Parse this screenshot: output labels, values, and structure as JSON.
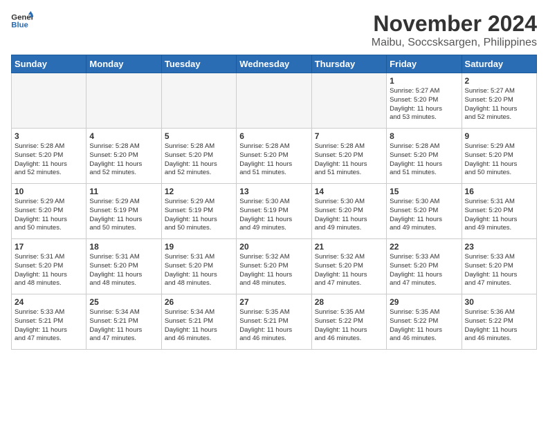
{
  "header": {
    "logo_line1": "General",
    "logo_line2": "Blue",
    "title": "November 2024",
    "subtitle": "Maibu, Soccsksargen, Philippines"
  },
  "days_of_week": [
    "Sunday",
    "Monday",
    "Tuesday",
    "Wednesday",
    "Thursday",
    "Friday",
    "Saturday"
  ],
  "weeks": [
    [
      {
        "day": "",
        "info": ""
      },
      {
        "day": "",
        "info": ""
      },
      {
        "day": "",
        "info": ""
      },
      {
        "day": "",
        "info": ""
      },
      {
        "day": "",
        "info": ""
      },
      {
        "day": "1",
        "info": "Sunrise: 5:27 AM\nSunset: 5:20 PM\nDaylight: 11 hours\nand 53 minutes."
      },
      {
        "day": "2",
        "info": "Sunrise: 5:27 AM\nSunset: 5:20 PM\nDaylight: 11 hours\nand 52 minutes."
      }
    ],
    [
      {
        "day": "3",
        "info": "Sunrise: 5:28 AM\nSunset: 5:20 PM\nDaylight: 11 hours\nand 52 minutes."
      },
      {
        "day": "4",
        "info": "Sunrise: 5:28 AM\nSunset: 5:20 PM\nDaylight: 11 hours\nand 52 minutes."
      },
      {
        "day": "5",
        "info": "Sunrise: 5:28 AM\nSunset: 5:20 PM\nDaylight: 11 hours\nand 52 minutes."
      },
      {
        "day": "6",
        "info": "Sunrise: 5:28 AM\nSunset: 5:20 PM\nDaylight: 11 hours\nand 51 minutes."
      },
      {
        "day": "7",
        "info": "Sunrise: 5:28 AM\nSunset: 5:20 PM\nDaylight: 11 hours\nand 51 minutes."
      },
      {
        "day": "8",
        "info": "Sunrise: 5:28 AM\nSunset: 5:20 PM\nDaylight: 11 hours\nand 51 minutes."
      },
      {
        "day": "9",
        "info": "Sunrise: 5:29 AM\nSunset: 5:20 PM\nDaylight: 11 hours\nand 50 minutes."
      }
    ],
    [
      {
        "day": "10",
        "info": "Sunrise: 5:29 AM\nSunset: 5:20 PM\nDaylight: 11 hours\nand 50 minutes."
      },
      {
        "day": "11",
        "info": "Sunrise: 5:29 AM\nSunset: 5:19 PM\nDaylight: 11 hours\nand 50 minutes."
      },
      {
        "day": "12",
        "info": "Sunrise: 5:29 AM\nSunset: 5:19 PM\nDaylight: 11 hours\nand 50 minutes."
      },
      {
        "day": "13",
        "info": "Sunrise: 5:30 AM\nSunset: 5:19 PM\nDaylight: 11 hours\nand 49 minutes."
      },
      {
        "day": "14",
        "info": "Sunrise: 5:30 AM\nSunset: 5:20 PM\nDaylight: 11 hours\nand 49 minutes."
      },
      {
        "day": "15",
        "info": "Sunrise: 5:30 AM\nSunset: 5:20 PM\nDaylight: 11 hours\nand 49 minutes."
      },
      {
        "day": "16",
        "info": "Sunrise: 5:31 AM\nSunset: 5:20 PM\nDaylight: 11 hours\nand 49 minutes."
      }
    ],
    [
      {
        "day": "17",
        "info": "Sunrise: 5:31 AM\nSunset: 5:20 PM\nDaylight: 11 hours\nand 48 minutes."
      },
      {
        "day": "18",
        "info": "Sunrise: 5:31 AM\nSunset: 5:20 PM\nDaylight: 11 hours\nand 48 minutes."
      },
      {
        "day": "19",
        "info": "Sunrise: 5:31 AM\nSunset: 5:20 PM\nDaylight: 11 hours\nand 48 minutes."
      },
      {
        "day": "20",
        "info": "Sunrise: 5:32 AM\nSunset: 5:20 PM\nDaylight: 11 hours\nand 48 minutes."
      },
      {
        "day": "21",
        "info": "Sunrise: 5:32 AM\nSunset: 5:20 PM\nDaylight: 11 hours\nand 47 minutes."
      },
      {
        "day": "22",
        "info": "Sunrise: 5:33 AM\nSunset: 5:20 PM\nDaylight: 11 hours\nand 47 minutes."
      },
      {
        "day": "23",
        "info": "Sunrise: 5:33 AM\nSunset: 5:20 PM\nDaylight: 11 hours\nand 47 minutes."
      }
    ],
    [
      {
        "day": "24",
        "info": "Sunrise: 5:33 AM\nSunset: 5:21 PM\nDaylight: 11 hours\nand 47 minutes."
      },
      {
        "day": "25",
        "info": "Sunrise: 5:34 AM\nSunset: 5:21 PM\nDaylight: 11 hours\nand 47 minutes."
      },
      {
        "day": "26",
        "info": "Sunrise: 5:34 AM\nSunset: 5:21 PM\nDaylight: 11 hours\nand 46 minutes."
      },
      {
        "day": "27",
        "info": "Sunrise: 5:35 AM\nSunset: 5:21 PM\nDaylight: 11 hours\nand 46 minutes."
      },
      {
        "day": "28",
        "info": "Sunrise: 5:35 AM\nSunset: 5:22 PM\nDaylight: 11 hours\nand 46 minutes."
      },
      {
        "day": "29",
        "info": "Sunrise: 5:35 AM\nSunset: 5:22 PM\nDaylight: 11 hours\nand 46 minutes."
      },
      {
        "day": "30",
        "info": "Sunrise: 5:36 AM\nSunset: 5:22 PM\nDaylight: 11 hours\nand 46 minutes."
      }
    ]
  ]
}
